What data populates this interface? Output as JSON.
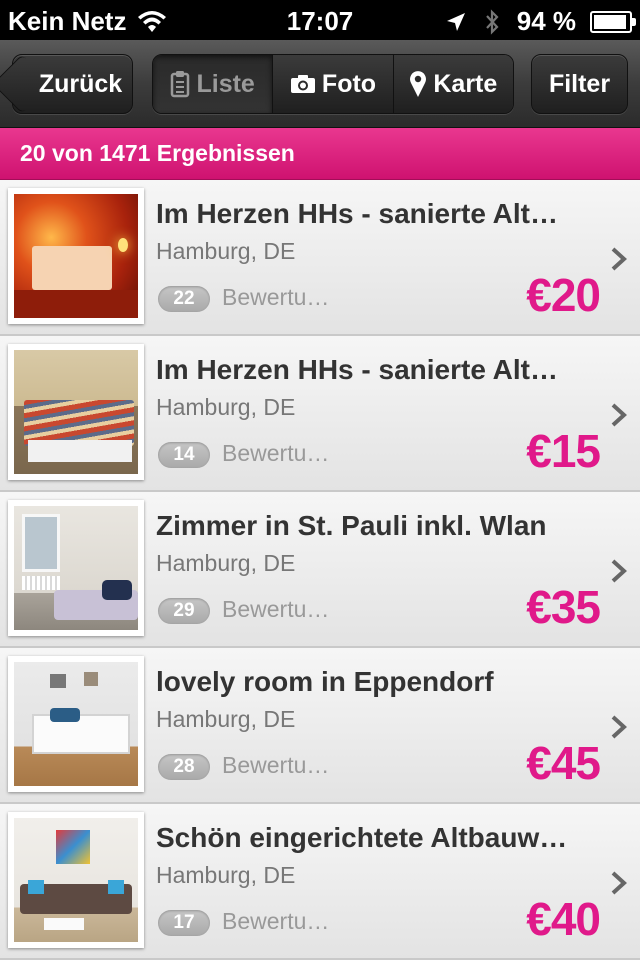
{
  "status": {
    "carrier": "Kein Netz",
    "time": "17:07",
    "battery": "94 %",
    "battery_level": 0.94
  },
  "nav": {
    "back_label": "Zurück",
    "segments": [
      {
        "label": "Liste",
        "icon": "clipboard-icon",
        "active": true
      },
      {
        "label": "Foto",
        "icon": "camera-icon",
        "active": false
      },
      {
        "label": "Karte",
        "icon": "map-pin-icon",
        "active": false
      }
    ],
    "filter_label": "Filter"
  },
  "result_count": "20 von 1471 Ergebnissen",
  "listings": [
    {
      "title": "Im Herzen HHs - sanierte Alt…",
      "location": "Hamburg, DE",
      "reviews_count": "22",
      "reviews_label": "Bewertu…",
      "price": "€20",
      "photo": "red-lit-bedroom"
    },
    {
      "title": "Im Herzen HHs - sanierte Alt…",
      "location": "Hamburg, DE",
      "reviews_count": "14",
      "reviews_label": "Bewertu…",
      "price": "€15",
      "photo": "bedroom-striped-duvet"
    },
    {
      "title": "Zimmer in St. Pauli inkl. Wlan",
      "location": "Hamburg, DE",
      "reviews_count": "29",
      "reviews_label": "Bewertu…",
      "price": "€35",
      "photo": "room-with-window"
    },
    {
      "title": "lovely room in Eppendorf",
      "location": "Hamburg, DE",
      "reviews_count": "28",
      "reviews_label": "Bewertu…",
      "price": "€45",
      "photo": "white-bed-room"
    },
    {
      "title": "Schön eingerichtete Altbauw…",
      "location": "Hamburg, DE",
      "reviews_count": "17",
      "reviews_label": "Bewertu…",
      "price": "€40",
      "photo": "living-room-sofa"
    }
  ],
  "colors": {
    "accent": "#e0198a",
    "result_bar": "#d81a7c"
  }
}
